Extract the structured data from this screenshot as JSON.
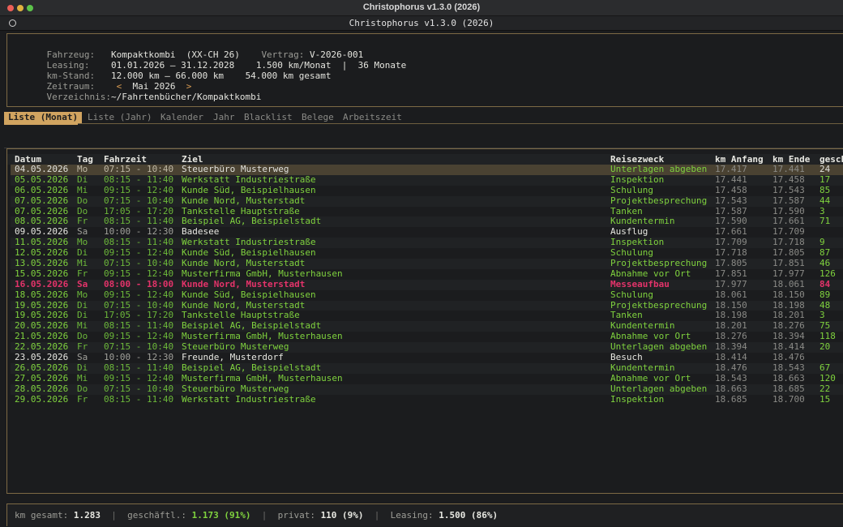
{
  "window": {
    "title": "Christophorus v1.3.0 (2026)"
  },
  "app": {
    "title": "Christophorus v1.3.0 (2026)"
  },
  "info": {
    "fahrzeug_label": "Fahrzeug:",
    "fahrzeug_value": "Kompaktkombi  (XX-CH 26)",
    "vertrag_label": "Vertrag:",
    "vertrag_value": "V-2026-001",
    "leasing_label": "Leasing:",
    "leasing_value": "01.01.2026 — 31.12.2028",
    "leasing_rate": "1.500 km/Monat",
    "leasing_sep": "|",
    "leasing_dauer": "36 Monate",
    "kmstand_label": "km-Stand:",
    "kmstand_value": "12.000 km — 66.000 km",
    "kmstand_gesamt": "54.000 km gesamt",
    "zeitraum_label": "Zeitraum:",
    "zeitraum_prev": "<",
    "zeitraum_value": "Mai 2026",
    "zeitraum_next": ">",
    "verzeichnis_label": "Verzeichnis:",
    "verzeichnis_value": "~/Fahrtenbücher/Kompaktkombi"
  },
  "tabs": [
    "Liste (Monat)",
    "Liste (Jahr)",
    "Kalender",
    "Jahr",
    "Blacklist",
    "Belege",
    "Arbeitszeit"
  ],
  "table": {
    "headers": [
      "Datum",
      "Tag",
      "Fahrzeit",
      "Ziel",
      "Reisezweck",
      "km Anfang",
      "km Ende",
      "gesch"
    ],
    "rows": [
      {
        "datum": "04.05.2026",
        "tag": "Mo",
        "zeit": "07:15 - 10:40",
        "ziel": "Steuerbüro Musterweg",
        "zweck": "Unterlagen abgeben",
        "kma": "17.417",
        "kme": "17.441",
        "km": "24",
        "type": "biz",
        "selected": true
      },
      {
        "datum": "05.05.2026",
        "tag": "Di",
        "zeit": "08:15 - 11:40",
        "ziel": "Werkstatt Industriestraße",
        "zweck": "Inspektion",
        "kma": "17.441",
        "kme": "17.458",
        "km": "17",
        "type": "biz"
      },
      {
        "datum": "06.05.2026",
        "tag": "Mi",
        "zeit": "09:15 - 12:40",
        "ziel": "Kunde Süd, Beispielhausen",
        "zweck": "Schulung",
        "kma": "17.458",
        "kme": "17.543",
        "km": "85",
        "type": "biz"
      },
      {
        "datum": "07.05.2026",
        "tag": "Do",
        "zeit": "07:15 - 10:40",
        "ziel": "Kunde Nord, Musterstadt",
        "zweck": "Projektbesprechung",
        "kma": "17.543",
        "kme": "17.587",
        "km": "44",
        "type": "biz"
      },
      {
        "datum": "07.05.2026",
        "tag": "Do",
        "zeit": "17:05 - 17:20",
        "ziel": "Tankstelle Hauptstraße",
        "zweck": "Tanken",
        "kma": "17.587",
        "kme": "17.590",
        "km": "3",
        "type": "biz"
      },
      {
        "datum": "08.05.2026",
        "tag": "Fr",
        "zeit": "08:15 - 11:40",
        "ziel": "Beispiel AG, Beispielstadt",
        "zweck": "Kundentermin",
        "kma": "17.590",
        "kme": "17.661",
        "km": "71",
        "type": "biz"
      },
      {
        "datum": "09.05.2026",
        "tag": "Sa",
        "zeit": "10:00 - 12:30",
        "ziel": "Badesee",
        "zweck": "Ausflug",
        "kma": "17.661",
        "kme": "17.709",
        "km": "",
        "type": "priv"
      },
      {
        "datum": "11.05.2026",
        "tag": "Mo",
        "zeit": "08:15 - 11:40",
        "ziel": "Werkstatt Industriestraße",
        "zweck": "Inspektion",
        "kma": "17.709",
        "kme": "17.718",
        "km": "9",
        "type": "biz"
      },
      {
        "datum": "12.05.2026",
        "tag": "Di",
        "zeit": "09:15 - 12:40",
        "ziel": "Kunde Süd, Beispielhausen",
        "zweck": "Schulung",
        "kma": "17.718",
        "kme": "17.805",
        "km": "87",
        "type": "biz"
      },
      {
        "datum": "13.05.2026",
        "tag": "Mi",
        "zeit": "07:15 - 10:40",
        "ziel": "Kunde Nord, Musterstadt",
        "zweck": "Projektbesprechung",
        "kma": "17.805",
        "kme": "17.851",
        "km": "46",
        "type": "biz"
      },
      {
        "datum": "15.05.2026",
        "tag": "Fr",
        "zeit": "09:15 - 12:40",
        "ziel": "Musterfirma GmbH, Musterhausen",
        "zweck": "Abnahme vor Ort",
        "kma": "17.851",
        "kme": "17.977",
        "km": "126",
        "type": "biz"
      },
      {
        "datum": "16.05.2026",
        "tag": "Sa",
        "zeit": "08:00 - 18:00",
        "ziel": "Kunde Nord, Musterstadt",
        "zweck": "Messeaufbau",
        "kma": "17.977",
        "kme": "18.061",
        "km": "84",
        "type": "hol"
      },
      {
        "datum": "18.05.2026",
        "tag": "Mo",
        "zeit": "09:15 - 12:40",
        "ziel": "Kunde Süd, Beispielhausen",
        "zweck": "Schulung",
        "kma": "18.061",
        "kme": "18.150",
        "km": "89",
        "type": "biz"
      },
      {
        "datum": "19.05.2026",
        "tag": "Di",
        "zeit": "07:15 - 10:40",
        "ziel": "Kunde Nord, Musterstadt",
        "zweck": "Projektbesprechung",
        "kma": "18.150",
        "kme": "18.198",
        "km": "48",
        "type": "biz"
      },
      {
        "datum": "19.05.2026",
        "tag": "Di",
        "zeit": "17:05 - 17:20",
        "ziel": "Tankstelle Hauptstraße",
        "zweck": "Tanken",
        "kma": "18.198",
        "kme": "18.201",
        "km": "3",
        "type": "biz"
      },
      {
        "datum": "20.05.2026",
        "tag": "Mi",
        "zeit": "08:15 - 11:40",
        "ziel": "Beispiel AG, Beispielstadt",
        "zweck": "Kundentermin",
        "kma": "18.201",
        "kme": "18.276",
        "km": "75",
        "type": "biz"
      },
      {
        "datum": "21.05.2026",
        "tag": "Do",
        "zeit": "09:15 - 12:40",
        "ziel": "Musterfirma GmbH, Musterhausen",
        "zweck": "Abnahme vor Ort",
        "kma": "18.276",
        "kme": "18.394",
        "km": "118",
        "type": "biz"
      },
      {
        "datum": "22.05.2026",
        "tag": "Fr",
        "zeit": "07:15 - 10:40",
        "ziel": "Steuerbüro Musterweg",
        "zweck": "Unterlagen abgeben",
        "kma": "18.394",
        "kme": "18.414",
        "km": "20",
        "type": "biz"
      },
      {
        "datum": "23.05.2026",
        "tag": "Sa",
        "zeit": "10:00 - 12:30",
        "ziel": "Freunde, Musterdorf",
        "zweck": "Besuch",
        "kma": "18.414",
        "kme": "18.476",
        "km": "",
        "type": "priv"
      },
      {
        "datum": "26.05.2026",
        "tag": "Di",
        "zeit": "08:15 - 11:40",
        "ziel": "Beispiel AG, Beispielstadt",
        "zweck": "Kundentermin",
        "kma": "18.476",
        "kme": "18.543",
        "km": "67",
        "type": "biz"
      },
      {
        "datum": "27.05.2026",
        "tag": "Mi",
        "zeit": "09:15 - 12:40",
        "ziel": "Musterfirma GmbH, Musterhausen",
        "zweck": "Abnahme vor Ort",
        "kma": "18.543",
        "kme": "18.663",
        "km": "120",
        "type": "biz"
      },
      {
        "datum": "28.05.2026",
        "tag": "Do",
        "zeit": "07:15 - 10:40",
        "ziel": "Steuerbüro Musterweg",
        "zweck": "Unterlagen abgeben",
        "kma": "18.663",
        "kme": "18.685",
        "km": "22",
        "type": "biz"
      },
      {
        "datum": "29.05.2026",
        "tag": "Fr",
        "zeit": "08:15 - 11:40",
        "ziel": "Werkstatt Industriestraße",
        "zweck": "Inspektion",
        "kma": "18.685",
        "kme": "18.700",
        "km": "15",
        "type": "biz"
      }
    ]
  },
  "footer": {
    "km_label": "km gesamt:",
    "km_value": "1.283",
    "sep": "|",
    "biz_label": "geschäftl.:",
    "biz_value": "1.173 (91%)",
    "priv_label": "privat:",
    "priv_value": "110 (9%)",
    "leasing_label": "Leasing:",
    "leasing_value": "1.500 (86%)"
  },
  "colors": {
    "accent": "#d1a460",
    "business": "#7fd23e",
    "holiday": "#e3336a",
    "border": "#7d6a45"
  }
}
